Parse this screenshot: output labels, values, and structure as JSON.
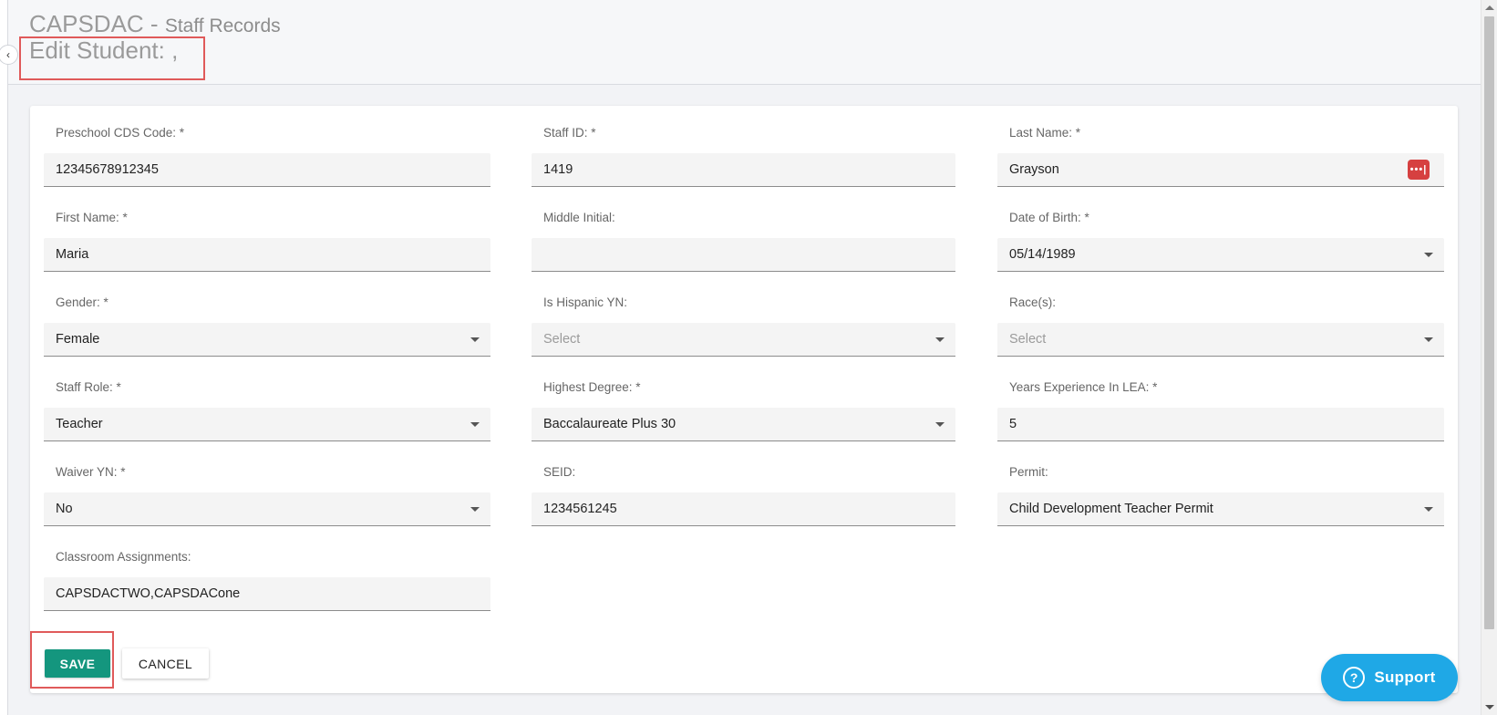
{
  "header": {
    "app_title": "CAPSDAC",
    "separator": " - ",
    "app_subtitle": "Staff Records",
    "page_title": "Edit Student: ,"
  },
  "form": {
    "fields": [
      {
        "label": "Preschool CDS Code: *",
        "value": "12345678912345",
        "type": "text"
      },
      {
        "label": "Staff ID: *",
        "value": "1419",
        "type": "text"
      },
      {
        "label": "Last Name: *",
        "value": "Grayson",
        "type": "text",
        "icon": "password-manager-icon"
      },
      {
        "label": "First Name: *",
        "value": "Maria",
        "type": "text"
      },
      {
        "label": "Middle Initial:",
        "value": "",
        "type": "text"
      },
      {
        "label": "Date of Birth: *",
        "value": "05/14/1989",
        "type": "select"
      },
      {
        "label": "Gender: *",
        "value": "Female",
        "type": "select"
      },
      {
        "label": "Is Hispanic YN:",
        "value": "Select",
        "type": "select",
        "placeholder": true
      },
      {
        "label": "Race(s):",
        "value": "Select",
        "type": "select",
        "placeholder": true
      },
      {
        "label": "Staff Role: *",
        "value": "Teacher",
        "type": "select"
      },
      {
        "label": "Highest Degree: *",
        "value": "Baccalaureate Plus 30",
        "type": "select"
      },
      {
        "label": "Years Experience In LEA: *",
        "value": "5",
        "type": "text"
      },
      {
        "label": "Waiver YN: *",
        "value": "No",
        "type": "select"
      },
      {
        "label": "SEID:",
        "value": "1234561245",
        "type": "text"
      },
      {
        "label": "Permit:",
        "value": "Child Development Teacher Permit",
        "type": "select"
      },
      {
        "label": "Classroom Assignments:",
        "value": "CAPSDACTWO,CAPSDACone",
        "type": "text"
      }
    ]
  },
  "actions": {
    "save_label": "SAVE",
    "cancel_label": "CANCEL"
  },
  "support": {
    "label": "Support",
    "icon": "question-circle-icon"
  },
  "colors": {
    "save_button": "#14967e",
    "support_button": "#1fa8e6",
    "highlight_box": "#e05a5a",
    "password_manager_icon": "#d64040"
  }
}
